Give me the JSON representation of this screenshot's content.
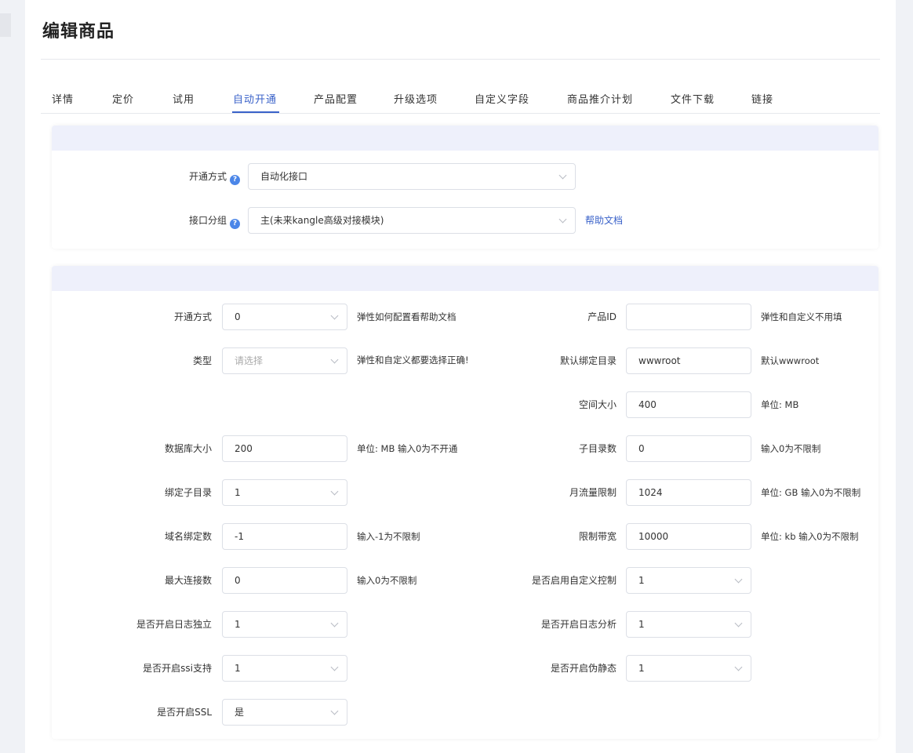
{
  "page": {
    "title": "编辑商品"
  },
  "tabs": [
    "详情",
    "定价",
    "试用",
    "自动开通",
    "产品配置",
    "升级选项",
    "自定义字段",
    "商品推介计划",
    "文件下载",
    "链接"
  ],
  "active_tab": "自动开通",
  "section1": {
    "open_mode_label": "开通方式",
    "open_mode_value": "自动化接口",
    "group_label": "接口分组",
    "group_value": "主(未来kangle高级对接模块)",
    "help_link": "帮助文档"
  },
  "section2": {
    "open_mode": {
      "label": "开通方式",
      "value": "0",
      "hint": "弹性如何配置看帮助文档"
    },
    "type": {
      "label": "类型",
      "placeholder": "请选择",
      "hint": "弹性和自定义都要选择正确!"
    },
    "db_size": {
      "label": "数据库大小",
      "value": "200",
      "hint": "单位: MB 输入0为不开通"
    },
    "bind_subdir": {
      "label": "绑定子目录",
      "value": "1"
    },
    "domain_bind": {
      "label": "域名绑定数",
      "value": "-1",
      "hint": "输入-1为不限制"
    },
    "max_conn": {
      "label": "最大连接数",
      "value": "0",
      "hint": "输入0为不限制"
    },
    "log_independent": {
      "label": "是否开启日志独立",
      "value": "1"
    },
    "ssi": {
      "label": "是否开启ssi支持",
      "value": "1"
    },
    "ssl": {
      "label": "是否开启SSL",
      "value": "是"
    },
    "product_id": {
      "label": "产品ID",
      "value": "",
      "hint": "弹性和自定义不用填"
    },
    "default_dir": {
      "label": "默认绑定目录",
      "value": "wwwroot",
      "hint": "默认wwwroot"
    },
    "space": {
      "label": "空间大小",
      "value": "400",
      "hint": "单位: MB"
    },
    "subdir_count": {
      "label": "子目录数",
      "value": "0",
      "hint": "输入0为不限制"
    },
    "traffic": {
      "label": "月流量限制",
      "value": "1024",
      "hint": "单位: GB 输入0为不限制"
    },
    "bandwidth": {
      "label": "限制带宽",
      "value": "10000",
      "hint": "单位: kb 输入0为不限制"
    },
    "custom_control": {
      "label": "是否启用自定义控制",
      "value": "1"
    },
    "log_analysis": {
      "label": "是否开启日志分析",
      "value": "1"
    },
    "rewrite": {
      "label": "是否开启伪静态",
      "value": "1"
    }
  },
  "colors": {
    "accent": "#3a62c9",
    "section_header": "#eef0fb"
  }
}
